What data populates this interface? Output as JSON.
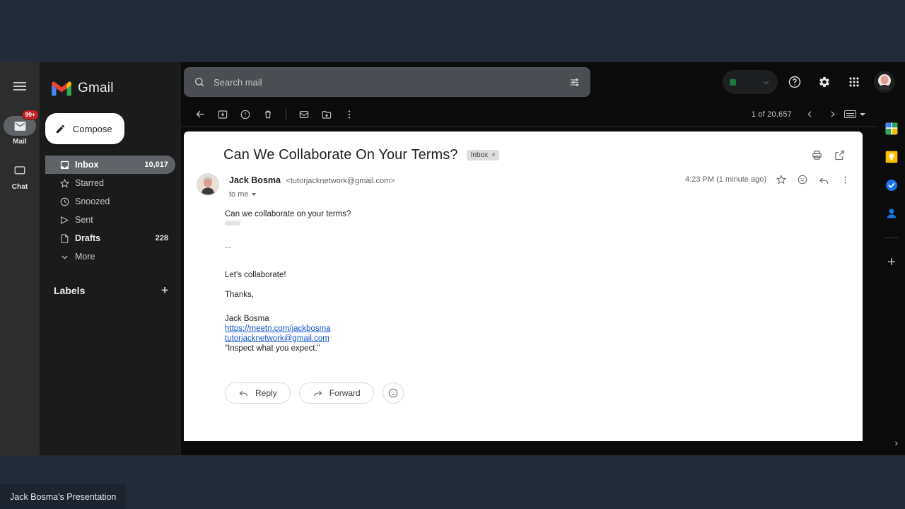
{
  "app": {
    "name": "Gmail"
  },
  "rail": {
    "menu_icon": "hamburger-icon",
    "items": [
      {
        "label": "Mail",
        "icon": "mail-icon",
        "badge": "99+",
        "active": true
      },
      {
        "label": "Chat",
        "icon": "chat-icon",
        "badge": "",
        "active": false
      }
    ]
  },
  "sidebar": {
    "compose_label": "Compose",
    "compose_icon": "pencil-icon",
    "items": [
      {
        "label": "Inbox",
        "icon": "inbox-icon",
        "count": "10,017",
        "selected": true,
        "bold": false
      },
      {
        "label": "Starred",
        "icon": "star-icon",
        "count": "",
        "selected": false,
        "bold": false
      },
      {
        "label": "Snoozed",
        "icon": "clock-icon",
        "count": "",
        "selected": false,
        "bold": false
      },
      {
        "label": "Sent",
        "icon": "send-icon",
        "count": "",
        "selected": false,
        "bold": false
      },
      {
        "label": "Drafts",
        "icon": "draft-icon",
        "count": "228",
        "selected": false,
        "bold": true
      },
      {
        "label": "More",
        "icon": "chevron-down-icon",
        "count": "",
        "selected": false,
        "bold": false
      }
    ],
    "labels_heading": "Labels",
    "labels_add": "+"
  },
  "search": {
    "placeholder": "Search mail",
    "search_icon": "search-icon",
    "options_icon": "tune-icon"
  },
  "header": {
    "status_pill": {
      "dot_color": "#1f7a3d",
      "caret": "chevron-down-icon"
    },
    "help_icon": "help-circle-icon",
    "settings_icon": "gear-icon",
    "apps_icon": "apps-grid-icon",
    "avatar_icon": "account-avatar"
  },
  "toolbar": {
    "back_icon": "arrow-back-icon",
    "archive_icon": "archive-icon",
    "spam_icon": "report-spam-icon",
    "delete_icon": "trash-icon",
    "unread_icon": "mark-unread-icon",
    "moveto_icon": "move-to-folder-icon",
    "more_icon": "more-vertical-icon",
    "counter": "1 of 20,657",
    "prev_icon": "chevron-left-icon",
    "next_icon": "chevron-right-icon",
    "keyboard_icon": "keyboard-icon"
  },
  "message": {
    "subject": "Can We Collaborate On Your Terms?",
    "label_chip": "Inbox",
    "label_chip_close": "×",
    "print_icon": "print-icon",
    "popout_icon": "open-in-new-icon",
    "sender_name": "Jack Bosma",
    "sender_email": "<tutorjacknetwork@gmail.com>",
    "recipient": "to me",
    "timestamp": "4:23 PM (1 minute ago)",
    "star_icon": "star-outline-icon",
    "react_icon": "emoji-react-icon",
    "reply_icon": "reply-icon",
    "more_icon": "more-vertical-icon",
    "body": {
      "line1": "Can we collaborate on your terms?",
      "separator": "--",
      "line2": "Let's collaborate!",
      "line3": "Thanks,",
      "sig_name": "Jack Bosma",
      "sig_url": "https://meetn.com/jackbosma",
      "sig_email": "tutorjacknetwork@gmail.com",
      "sig_quote": "\"Inspect what you expect.\""
    },
    "actions": {
      "reply_label": "Reply",
      "reply_icon": "reply-icon",
      "forward_label": "Forward",
      "forward_icon": "forward-icon",
      "react_icon": "emoji-react-icon"
    }
  },
  "side_panel": {
    "items": [
      {
        "name": "google-calendar-icon",
        "label": "Calendar",
        "day": "31"
      },
      {
        "name": "google-keep-icon",
        "label": "Keep",
        "day": ""
      },
      {
        "name": "google-tasks-icon",
        "label": "Tasks",
        "day": ""
      },
      {
        "name": "google-contacts-icon",
        "label": "Contacts",
        "day": ""
      }
    ],
    "add_label": "+",
    "expand_icon": "›"
  },
  "taskbar": {
    "window_title": "Jack Bosma's Presentation"
  }
}
